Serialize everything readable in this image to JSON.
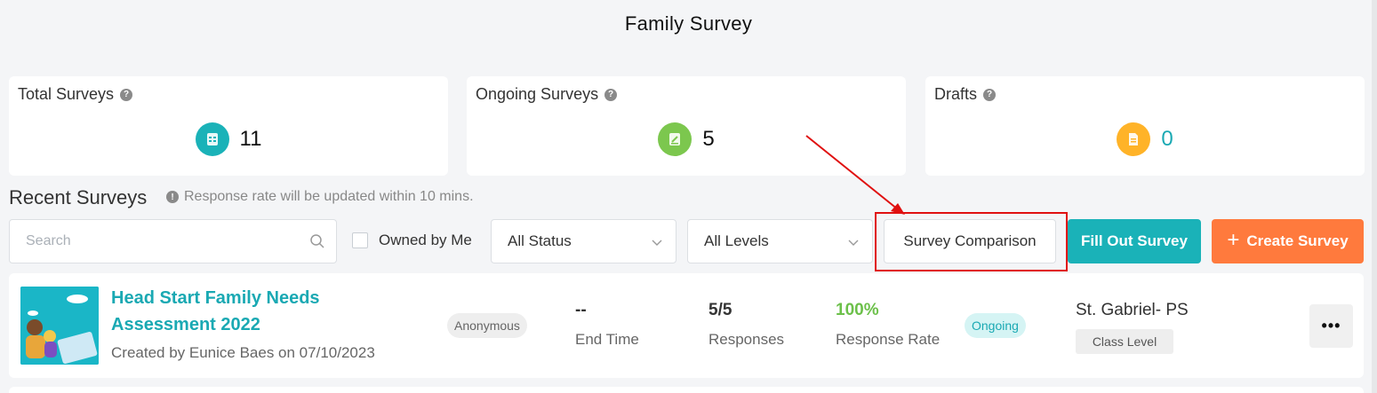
{
  "page": {
    "title": "Family Survey"
  },
  "stats": [
    {
      "label": "Total Surveys",
      "value": "11",
      "icon": "clipboard-icon",
      "color": "#1ab2b8"
    },
    {
      "label": "Ongoing Surveys",
      "value": "5",
      "icon": "edit-document-icon",
      "color": "#7cc74e"
    },
    {
      "label": "Drafts",
      "value": "0",
      "icon": "draft-document-icon",
      "color": "#ffb328"
    }
  ],
  "recent": {
    "title": "Recent Surveys",
    "note": "Response rate will be updated within 10 mins."
  },
  "toolbar": {
    "search_placeholder": "Search",
    "owned_by_me": "Owned by Me",
    "status_select": "All Status",
    "levels_select": "All Levels",
    "compare_label": "Survey Comparison",
    "fill_label": "Fill Out Survey",
    "create_label": "Create Survey",
    "create_icon": "plus-icon"
  },
  "surveys": [
    {
      "name": "Head Start Family Needs Assessment 2022",
      "created_by": "Created by Eunice Baes on 07/10/2023",
      "visibility": "Anonymous",
      "end_time_value": "--",
      "end_time_label": "End Time",
      "responses_value": "5/5",
      "responses_label": "Responses",
      "response_rate_value": "100%",
      "response_rate_label": "Response Rate",
      "status": "Ongoing",
      "school": "St. Gabriel- PS",
      "level": "Class Level",
      "more_label": "•••"
    }
  ],
  "colors": {
    "accent": "#1ab2b8",
    "create": "#ff7a3d",
    "highlight": "#e01010",
    "green": "#6cc04a"
  }
}
